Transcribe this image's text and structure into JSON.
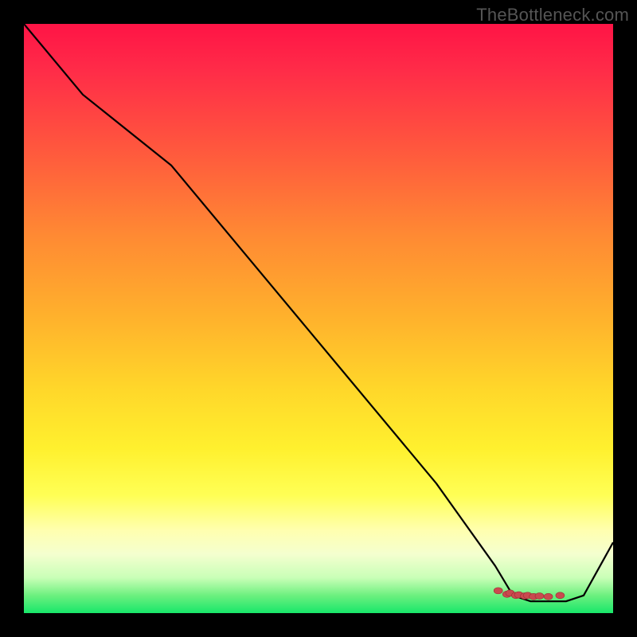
{
  "brand": {
    "watermark": "TheBottleneck.com"
  },
  "colors": {
    "line": "#000000",
    "marker_fill": "#c94a4f",
    "marker_stroke": "#9c2f34",
    "gradient_top": "#ff1446",
    "gradient_bottom": "#18e76a",
    "background": "#000000"
  },
  "chart_data": {
    "type": "line",
    "title": "",
    "xlabel": "",
    "ylabel": "",
    "xlim": [
      0,
      100
    ],
    "ylim": [
      0,
      100
    ],
    "grid": false,
    "series": [
      {
        "name": "curve",
        "x": [
          0,
          10,
          25,
          40,
          55,
          70,
          80,
          83,
          86,
          89,
          92,
          95,
          100
        ],
        "values": [
          100,
          88,
          76,
          58,
          40,
          22,
          8,
          3,
          2,
          2,
          2,
          3,
          12
        ]
      }
    ],
    "markers": {
      "name": "scatter-cluster",
      "x": [
        80.5,
        82.0,
        82.5,
        83.5,
        84.0,
        85.0,
        85.5,
        86.5,
        87.5,
        89.0,
        91.0
      ],
      "values": [
        3.8,
        3.2,
        3.4,
        3.0,
        3.1,
        2.9,
        3.0,
        2.8,
        2.9,
        2.8,
        3.0
      ]
    }
  }
}
